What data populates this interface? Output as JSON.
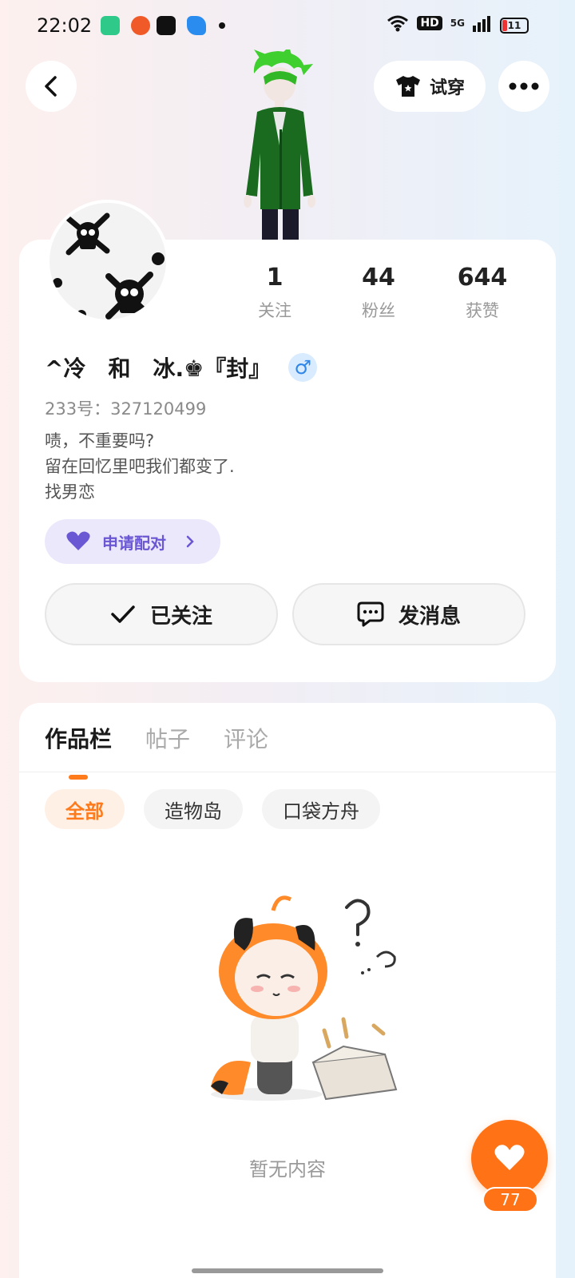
{
  "status_bar": {
    "time": "22:02",
    "hd_label": "HD",
    "network_label": "5G",
    "battery_level": "11"
  },
  "top_nav": {
    "try_on_label": "试穿"
  },
  "profile": {
    "stats": [
      {
        "value": "1",
        "label": "关注"
      },
      {
        "value": "44",
        "label": "粉丝"
      },
      {
        "value": "644",
        "label": "获赞"
      }
    ],
    "nickname": "^冷　和　冰.♚『封』",
    "gender_symbol": "♂",
    "uid": "233号：327120499",
    "bio_lines": [
      "啧，不重要吗?",
      "留在回忆里吧我们都变了.",
      "找男恋"
    ],
    "match_label": "申请配对",
    "follow_label": "已关注",
    "message_label": "发消息"
  },
  "content": {
    "tabs": [
      "作品栏",
      "帖子",
      "评论"
    ],
    "active_tab": 0,
    "filters": [
      "全部",
      "造物岛",
      "口袋方舟"
    ],
    "active_filter": 0,
    "empty_text": "暂无内容"
  },
  "like_fab": {
    "count": "77"
  },
  "colors": {
    "accent": "#ff7316",
    "match_purple": "#6a57d4",
    "gender_blue": "#2f86e8"
  },
  "icons": [
    "back-icon",
    "shirt-icon",
    "more-icon",
    "heart-icon",
    "check-icon",
    "chat-icon",
    "chevron-right-icon",
    "male-icon"
  ]
}
